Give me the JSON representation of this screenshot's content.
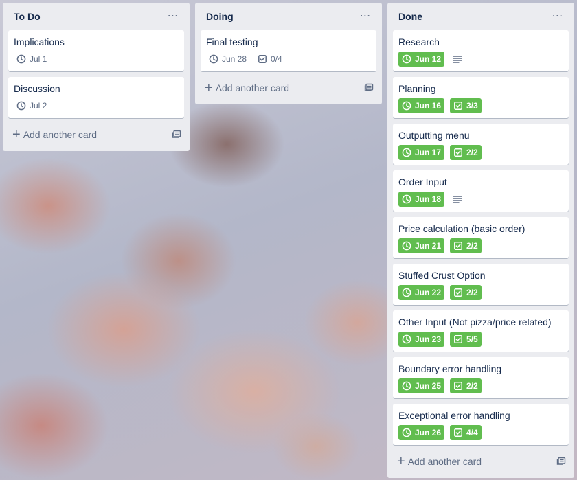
{
  "lists": [
    {
      "title": "To Do",
      "add_card_label": "Add another card",
      "cards": [
        {
          "title": "Implications",
          "due": "Jul 1",
          "due_complete": false
        },
        {
          "title": "Discussion",
          "due": "Jul 2",
          "due_complete": false
        }
      ]
    },
    {
      "title": "Doing",
      "add_card_label": "Add another card",
      "cards": [
        {
          "title": "Final testing",
          "due": "Jun 28",
          "due_complete": false,
          "checklist": "0/4"
        }
      ]
    },
    {
      "title": "Done",
      "add_card_label": "Add another card",
      "cards": [
        {
          "title": "Research",
          "due": "Jun 12",
          "due_complete": true,
          "description": true
        },
        {
          "title": "Planning",
          "due": "Jun 16",
          "due_complete": true,
          "checklist": "3/3"
        },
        {
          "title": "Outputting menu",
          "due": "Jun 17",
          "due_complete": true,
          "checklist": "2/2"
        },
        {
          "title": "Order Input",
          "due": "Jun 18",
          "due_complete": true,
          "description": true
        },
        {
          "title": "Price calculation (basic order)",
          "due": "Jun 21",
          "due_complete": true,
          "checklist": "2/2"
        },
        {
          "title": "Stuffed Crust Option",
          "due": "Jun 22",
          "due_complete": true,
          "checklist": "2/2"
        },
        {
          "title": "Other Input (Not pizza/price related)",
          "due": "Jun 23",
          "due_complete": true,
          "checklist": "5/5"
        },
        {
          "title": "Boundary error handling",
          "due": "Jun 25",
          "due_complete": true,
          "checklist": "2/2"
        },
        {
          "title": "Exceptional error handling",
          "due": "Jun 26",
          "due_complete": true,
          "checklist": "4/4"
        }
      ]
    }
  ],
  "icons": {
    "list_menu": "more-horizontal-icon",
    "due": "clock-icon",
    "checklist": "checkbox-icon",
    "description": "description-lines-icon",
    "add": "plus-icon",
    "template": "card-template-icon"
  },
  "colors": {
    "list_bg": "#ebecf0",
    "card_bg": "#ffffff",
    "due_complete": "#61bd4f",
    "muted_text": "#5e6c84",
    "text": "#172b4d"
  }
}
